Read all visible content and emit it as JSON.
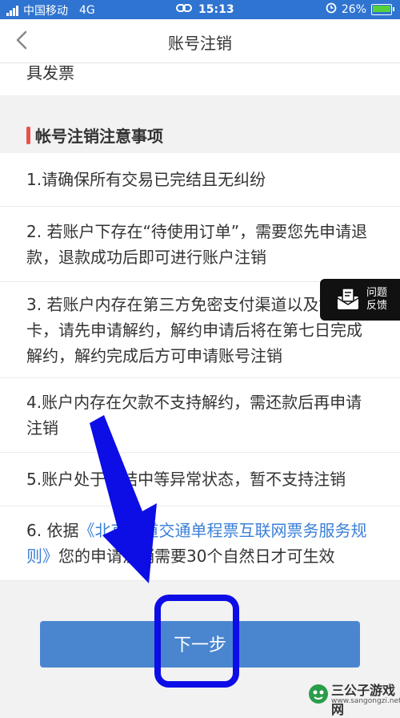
{
  "status_bar": {
    "carrier": "中国移动",
    "network": "4G",
    "time": "15:13",
    "battery": "26%",
    "battery_level": 0.26,
    "bg_color": "#2f74d0"
  },
  "nav": {
    "title": "账号注销",
    "back_icon": "chevron-left-icon"
  },
  "partial_text": "具发票",
  "section": {
    "title": "帐号注销注意事项",
    "accent_color": "#e8524a"
  },
  "items": [
    {
      "text": "1.请确保所有交易已完结且无纠纷"
    },
    {
      "text": "2. 若账户下存在“待使用订单”，需要您先申请退款，退款成功后即可进行账户注销"
    },
    {
      "text": "3. 若账户内存在第三方免密支付渠道以及银行卡，请先申请解约，解约申请后将在第七日完成解约，解约完成后方可申请账号注销"
    },
    {
      "text": "4.账户内存在欠款不支持解约，需还款后再申请注销"
    },
    {
      "text": "5.账户处于冻结中等异常状态，暂不支持注销"
    },
    {
      "prefix": "6. 依据",
      "link": "《北京轨道交通单程票互联网票务服务规则》",
      "suffix": "您的申请注销需要30个自然日才可生效"
    }
  ],
  "feedback": {
    "line1": "问题",
    "line2": "反馈"
  },
  "next_button": {
    "label": "下一步",
    "color": "#4a86cf"
  },
  "annotation": {
    "color": "#0d0de6"
  },
  "watermark": {
    "name": "三公子游戏网",
    "url": "www.sangongzi.net"
  }
}
